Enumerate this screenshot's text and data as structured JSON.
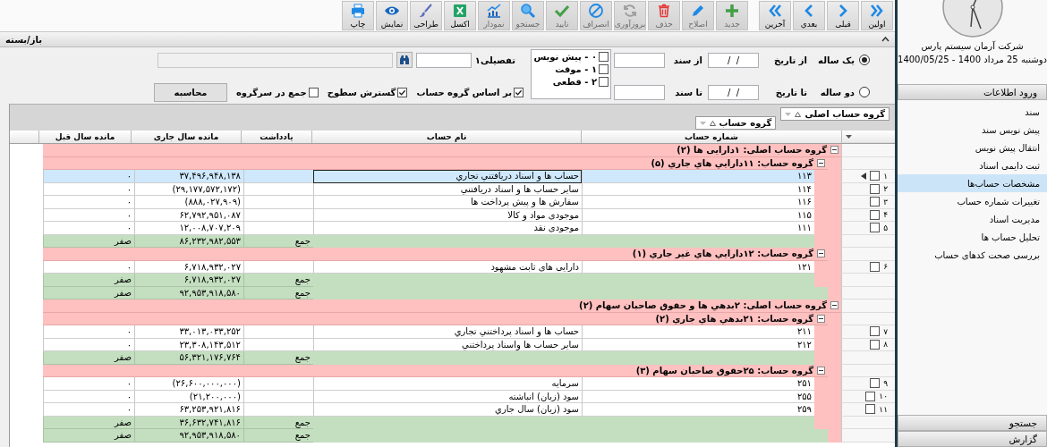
{
  "toolbar": {
    "buttons": [
      {
        "label": "اولین",
        "disabled": false
      },
      {
        "label": "قبلی",
        "disabled": false
      },
      {
        "label": "بعدي",
        "disabled": false
      },
      {
        "label": "آخرین",
        "disabled": false
      },
      {
        "label": "جدید",
        "disabled": true
      },
      {
        "label": "اصلاح",
        "disabled": true
      },
      {
        "label": "حذف",
        "disabled": true
      },
      {
        "label": "بروزآوری",
        "disabled": true
      },
      {
        "label": "انصراف",
        "disabled": true
      },
      {
        "label": "تایید",
        "disabled": true
      },
      {
        "label": "جستجو",
        "disabled": true
      },
      {
        "label": "نمودار",
        "disabled": true
      },
      {
        "label": "اکسل",
        "disabled": false
      },
      {
        "label": "طراحی",
        "disabled": false
      },
      {
        "label": "نمایش",
        "disabled": false
      },
      {
        "label": "چاپ",
        "disabled": false
      }
    ]
  },
  "filter_bar": {
    "title": "باز/بسته",
    "expanded": true
  },
  "filters": {
    "period_options": [
      {
        "label": "یک ساله",
        "selected": true
      },
      {
        "label": "دو ساله",
        "selected": false
      }
    ],
    "from_date": {
      "label": "از تاریخ",
      "value": "/  /"
    },
    "to_date": {
      "label": "تا تاریخ",
      "value": "/  /"
    },
    "from_doc": {
      "label": "از سند"
    },
    "to_doc": {
      "label": "تا سند"
    },
    "status_list": [
      {
        "label": "۰ - پیش نویس",
        "checked": false
      },
      {
        "label": "۱ - موقت",
        "checked": false
      },
      {
        "label": "۲ - قطعی",
        "checked": false
      }
    ],
    "detail": {
      "label": "تفصیلی۱"
    },
    "options": [
      {
        "label": "بر اساس گروه حساب",
        "checked": true
      },
      {
        "label": "گسترش سطوح",
        "checked": true
      },
      {
        "label": "جمع در سرگروه",
        "checked": false
      }
    ],
    "calculate_button": "محاسبه"
  },
  "group_panel": {
    "chips": [
      {
        "label": "گروه حساب اصلی"
      },
      {
        "label": "گروه حساب"
      }
    ]
  },
  "table": {
    "columns": [
      "شماره حساب",
      "نام حساب",
      "یادداشت",
      "مانده سال جاری",
      "مانده سال قبل"
    ],
    "groups": [
      {
        "label": "گروه حساب اصلی: ۱دارایی ها (۲)",
        "expanded": true,
        "children": [
          {
            "label": "گروه حساب: ۱۱دارایي هاي جاري (۵)",
            "expanded": true,
            "rows": [
              {
                "index": "۱",
                "selected": true,
                "checked": false,
                "number": "۱۱۳",
                "name": "حساب ها و اسناد دريافتني تجاري",
                "current": "۳۷,۴۹۶,۹۴۸,۱۳۸",
                "previous": "۰"
              },
              {
                "index": "۲",
                "selected": false,
                "checked": false,
                "number": "۱۱۴",
                "name": "ساير حساب ها و اسناد دريافتني",
                "current": "(۲۹,۱۷۷,۵۷۲,۱۷۲)",
                "previous": "۰"
              },
              {
                "index": "۳",
                "selected": false,
                "checked": false,
                "number": "۱۱۶",
                "name": "سفارش ها و پيش پرداخت ها",
                "current": "(۸۸۸,۰۲۷,۹۰۹)",
                "previous": "۰"
              },
              {
                "index": "۴",
                "selected": false,
                "checked": false,
                "number": "۱۱۵",
                "name": "موجودی مواد و کالا",
                "current": "۶۲,۷۹۲,۹۵۱,۰۸۷",
                "previous": "۰"
              },
              {
                "index": "۵",
                "selected": false,
                "checked": false,
                "number": "۱۱۱",
                "name": "موجودی نقد",
                "current": "۱۲,۰۰۸,۷۰۷,۲۰۹",
                "previous": "۰"
              }
            ],
            "total": {
              "label": "جمع",
              "current": "۸۶,۲۳۲,۹۸۲,۵۵۳",
              "previous": "صفر"
            }
          },
          {
            "label": "گروه حساب: ۱۲دارایي هاي غير جاري (۱)",
            "expanded": true,
            "rows": [
              {
                "index": "۶",
                "selected": false,
                "checked": false,
                "number": "۱۲۱",
                "name": "دارایی های ثابت مشهود",
                "current": "۶,۷۱۸,۹۳۲,۰۲۷",
                "previous": "۰"
              }
            ],
            "total": {
              "label": "جمع",
              "current": "۶,۷۱۸,۹۳۲,۰۲۷",
              "previous": "صفر"
            }
          }
        ],
        "total": {
          "label": "جمع",
          "current": "۹۲,۹۵۳,۹۱۸,۵۸۰",
          "previous": "صفر"
        }
      },
      {
        "label": "گروه حساب اصلی: ۲بدهي ها و حقوق صاحبان سهام (۲)",
        "expanded": true,
        "children": [
          {
            "label": "گروه حساب: ۲۱بدهي هاي جاري (۲)",
            "expanded": true,
            "rows": [
              {
                "index": "۷",
                "selected": false,
                "checked": false,
                "number": "۲۱۱",
                "name": "حساب ها و اسناد پرداختني تجاري",
                "current": "۳۳,۰۱۳,۰۳۳,۲۵۲",
                "previous": "۰"
              },
              {
                "index": "۸",
                "selected": false,
                "checked": false,
                "number": "۲۱۲",
                "name": "ساير حساب ها واسناد پرداختني",
                "current": "۲۳,۳۰۸,۱۴۳,۵۱۲",
                "previous": "۰"
              }
            ],
            "total": {
              "label": "جمع",
              "current": "۵۶,۳۲۱,۱۷۶,۷۶۴",
              "previous": "صفر"
            }
          },
          {
            "label": "گروه حساب: ۲۵حقوق صاحبان سهام (۳)",
            "expanded": true,
            "rows": [
              {
                "index": "۹",
                "selected": false,
                "checked": false,
                "number": "۲۵۱",
                "name": "سرمايه",
                "current": "(۲۶,۶۰۰,۰۰۰,۰۰۰)",
                "previous": "۰"
              },
              {
                "index": "۱۰",
                "selected": false,
                "checked": false,
                "number": "۲۵۵",
                "name": "سود (زيان) انباشته",
                "current": "(۲۱,۲۰۰,۰۰۰)",
                "previous": "۰"
              },
              {
                "index": "۱۱",
                "selected": false,
                "checked": false,
                "number": "۲۵۹",
                "name": "سود (زيان) سال جاري",
                "current": "۶۳,۲۵۳,۹۲۱,۸۱۶",
                "previous": "۰"
              }
            ],
            "total": {
              "label": "جمع",
              "current": "۳۶,۶۳۲,۷۴۱,۸۱۶",
              "previous": "صفر"
            }
          }
        ],
        "total": {
          "label": "جمع",
          "current": "۹۲,۹۵۳,۹۱۸,۵۸۰",
          "previous": "صفر"
        }
      }
    ]
  },
  "sidebar": {
    "company": "شرکت آرمان سیستم پارس",
    "date": "دوشنبه 25 مرداد 1400 - 1400/05/25",
    "sections": [
      {
        "label": "ورود اطلاعات",
        "expanded": true,
        "items": [
          {
            "label": "سند",
            "selected": false
          },
          {
            "label": "پیش نویس سند",
            "selected": false
          },
          {
            "label": "انتقال پیش نویس",
            "selected": false
          },
          {
            "label": "ثبت دایمی اسناد",
            "selected": false
          },
          {
            "label": "مشخصات حساب‌ها",
            "selected": true
          },
          {
            "label": "تغییرات شماره حساب",
            "selected": false
          },
          {
            "label": "مدیریت اسناد",
            "selected": false
          },
          {
            "label": "تحلیل حساب ها",
            "selected": false
          },
          {
            "label": "بررسی صحت کدهای حساب",
            "selected": false
          }
        ]
      },
      {
        "label": "جستجو",
        "expanded": false
      },
      {
        "label": "گزارش",
        "expanded": false
      }
    ]
  }
}
